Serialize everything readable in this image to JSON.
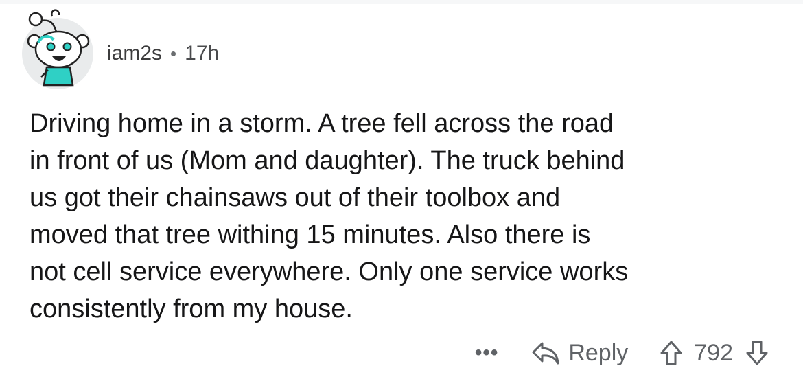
{
  "comment": {
    "username": "iam2s",
    "separator": "•",
    "age": "17h",
    "lines": [
      "Driving home in a storm.  A tree fell across the road",
      "in front of us (Mom and daughter). The truck behind",
      "us got their chainsaws out of their toolbox and",
      "moved that tree withing 15 minutes.  Also there is",
      "not cell service everywhere.  Only one service works",
      "consistently from my house."
    ]
  },
  "actions": {
    "more": "•••",
    "reply_label": "Reply",
    "score": "792"
  },
  "icons": {
    "avatar": "snoo-avatar",
    "reply": "reply-arrow-icon",
    "upvote": "upvote-arrow-icon",
    "downvote": "downvote-arrow-icon"
  },
  "colors": {
    "avatar_bg": "#e9ebec",
    "avatar_accent": "#2fd0c5",
    "text": "#161617",
    "meta": "#5f6266"
  }
}
